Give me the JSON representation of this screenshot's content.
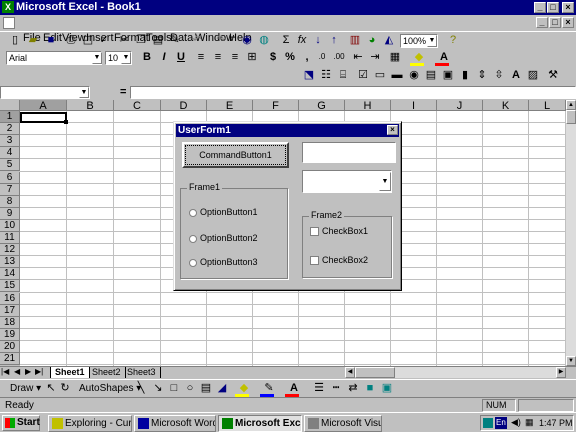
{
  "window": {
    "title": "Microsoft Excel - Book1"
  },
  "menu": [
    "File",
    "Edit",
    "View",
    "Insert",
    "Format",
    "Tools",
    "Data",
    "Window",
    "Help"
  ],
  "formatting": {
    "font": "Arial",
    "size": "10",
    "zoom": "100%"
  },
  "formula_bar": {
    "name_box": "",
    "equals": "="
  },
  "columns": [
    "A",
    "B",
    "C",
    "D",
    "E",
    "F",
    "G",
    "H",
    "I",
    "J",
    "K",
    "L"
  ],
  "rows": [
    "1",
    "2",
    "3",
    "4",
    "5",
    "6",
    "7",
    "8",
    "9",
    "10",
    "11",
    "12",
    "13",
    "14",
    "15",
    "16",
    "17",
    "18",
    "19",
    "20",
    "21"
  ],
  "sheets": [
    "Sheet1",
    "Sheet2",
    "Sheet3"
  ],
  "userform": {
    "title": "UserForm1",
    "command_button": "CommandButton1",
    "frame1": "Frame1",
    "options": [
      "OptionButton1",
      "OptionButton2",
      "OptionButton3"
    ],
    "frame2": "Frame2",
    "checkboxes": [
      "CheckBox1",
      "CheckBox2"
    ]
  },
  "drawing": {
    "draw": "Draw",
    "autoshapes": "AutoShapes"
  },
  "status": {
    "ready": "Ready",
    "num": "NUM"
  },
  "taskbar": {
    "start": "Start",
    "tasks": [
      "Exploring - CursL...",
      "Microsoft Word -...",
      "Microsoft Exc...",
      "Microsoft Visual ..."
    ],
    "clock": "1:47 PM",
    "lang": "En"
  }
}
